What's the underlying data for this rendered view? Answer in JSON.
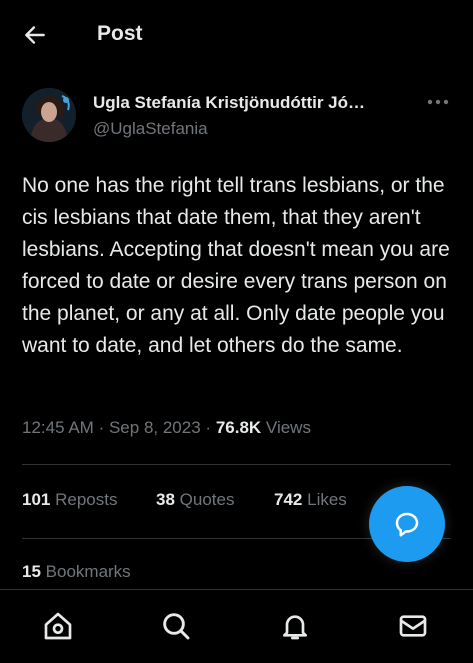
{
  "header": {
    "title": "Post"
  },
  "post": {
    "author_name": "Ugla Stefanía Kristjönudóttir Jó…",
    "handle": "@UglaStefania",
    "text": "No one has the right tell trans lesbians, or the cis lesbians that date them, that they aren't lesbians. Accepting that doesn't mean you are forced to date or desire every trans person on the planet, or any at all. Only date people you want to date, and let others do the same.",
    "time": "12:45 AM",
    "sep": "·",
    "date": "Sep 8, 2023",
    "views_count": "76.8K",
    "views_label": "Views"
  },
  "stats": {
    "reposts_count": "101",
    "reposts_label": "Reposts",
    "quotes_count": "38",
    "quotes_label": "Quotes",
    "likes_count": "742",
    "likes_label": "Likes",
    "bookmarks_count": "15",
    "bookmarks_label": "Bookmarks"
  },
  "icons": {
    "back": "arrow-left-icon",
    "more": "more-horizontal-icon",
    "fab": "reply-bubble-icon",
    "nav": [
      "home-icon",
      "search-icon",
      "bell-icon",
      "mail-icon"
    ]
  },
  "colors": {
    "background": "#000000",
    "text": "#e7e9ea",
    "muted": "#71767b",
    "accent": "#1d9bf0",
    "divider": "#2f3336"
  }
}
